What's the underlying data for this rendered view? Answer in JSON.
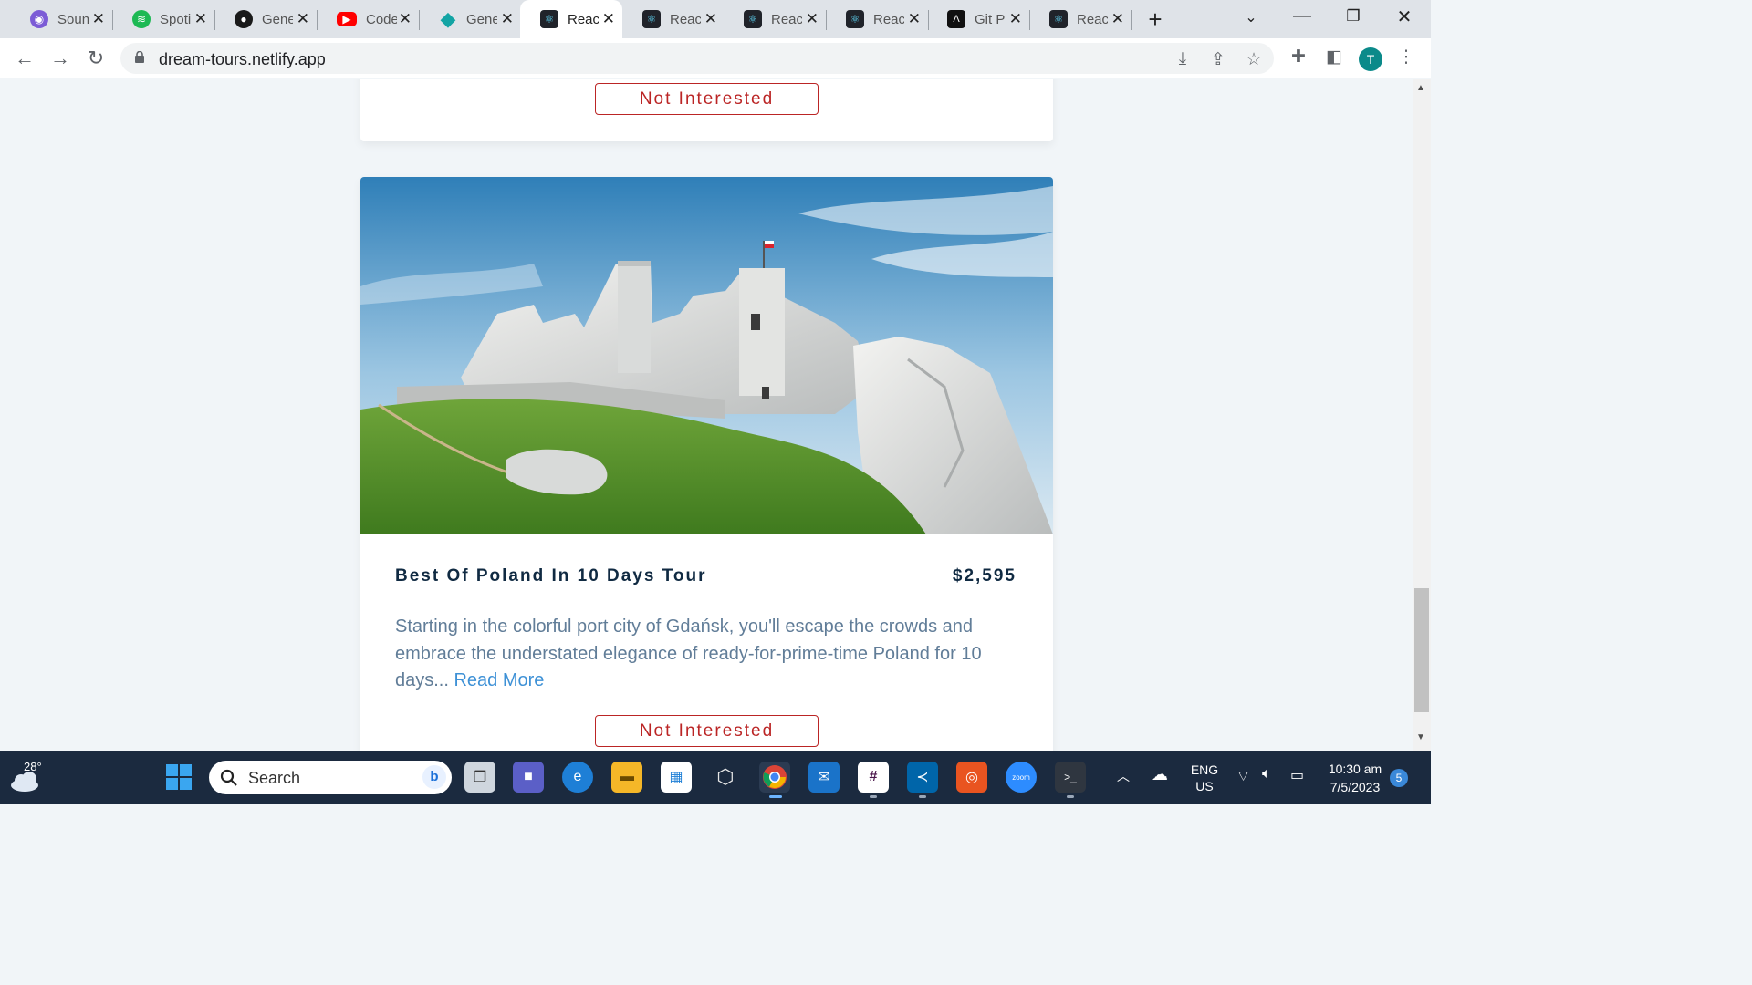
{
  "browser": {
    "tabs": [
      {
        "title": "Soun",
        "icon": "soundcloud-icon",
        "color": "#7c5cd6",
        "active": false
      },
      {
        "title": "Spoti",
        "icon": "spotify-icon",
        "color": "#1db954",
        "active": false
      },
      {
        "title": "Gene",
        "icon": "github-icon",
        "color": "#1a1a1a",
        "active": false
      },
      {
        "title": "Code",
        "icon": "youtube-icon",
        "color": "#ff0000",
        "active": false
      },
      {
        "title": "Gene",
        "icon": "diamond-icon",
        "color": "#13a4a4",
        "active": false
      },
      {
        "title": "Reac",
        "icon": "react-icon",
        "color": "#20232a",
        "active": true
      },
      {
        "title": "Reac",
        "icon": "react-icon",
        "color": "#20232a",
        "active": false
      },
      {
        "title": "Reac",
        "icon": "react-icon",
        "color": "#20232a",
        "active": false
      },
      {
        "title": "Reac",
        "icon": "react-icon",
        "color": "#20232a",
        "active": false
      },
      {
        "title": "Git P",
        "icon": "cli-icon",
        "color": "#111111",
        "active": false
      },
      {
        "title": "Reac",
        "icon": "react-icon",
        "color": "#20232a",
        "active": false
      }
    ],
    "url": "dream-tours.netlify.app",
    "profile_initial": "T"
  },
  "page": {
    "prev_tour": {
      "button_label": "Not Interested"
    },
    "tour": {
      "name": "Best Of Poland In 10 Days Tour",
      "price": "$2,595",
      "info": "Starting in the colorful port city of Gdańsk, you'll escape the crowds and embrace the understated elegance of ready-for-prime-time Poland for 10 days...",
      "read_more": "Read More",
      "button_label": "Not Interested",
      "image": "castle-ruins-photo"
    }
  },
  "taskbar": {
    "weather_temp": "28°",
    "search_label": "Search",
    "lang_line1": "ENG",
    "lang_line2": "US",
    "time": "10:30 am",
    "date": "7/5/2023",
    "notifications": "5"
  },
  "colors": {
    "title": "#102a42",
    "price": "#102a42",
    "body_text": "#617d98",
    "link": "#3e91d6",
    "danger": "#bb2525",
    "page_bg": "#f1f5f8"
  }
}
